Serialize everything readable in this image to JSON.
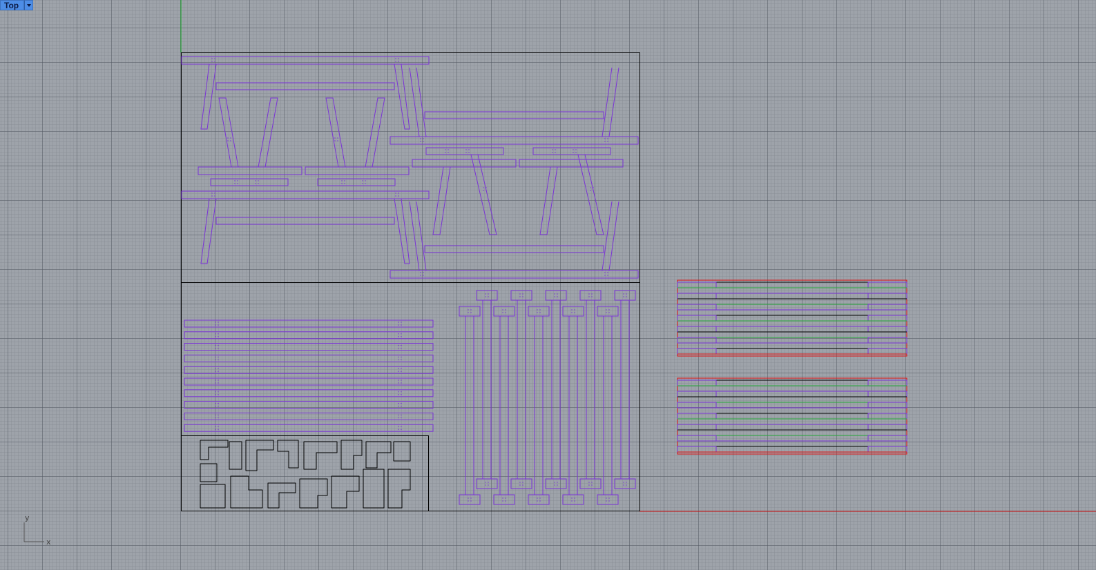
{
  "viewport": {
    "name": "Top",
    "menu_icon": "dropdown-arrow-icon"
  },
  "axes": {
    "x_label": "x",
    "y_label": "y"
  },
  "colors": {
    "background": "#9ea3aa",
    "grid": "#50566a",
    "curve": "#7a33d6",
    "boundary": "#000000",
    "x_axis": "#cc1111",
    "y_axis": "#11aa22",
    "stock_red": "#e01010",
    "stock_green": "#27a83a"
  }
}
